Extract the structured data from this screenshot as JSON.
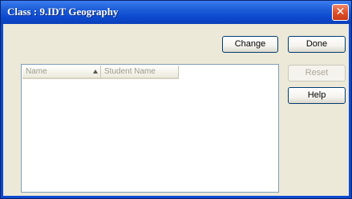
{
  "window": {
    "title": "Class : 9.IDT Geography",
    "close_glyph": "✕"
  },
  "buttons": {
    "change": "Change",
    "done": "Done",
    "reset": "Reset",
    "help": "Help"
  },
  "list": {
    "columns": [
      {
        "label": "Name",
        "sorted": "ascending"
      },
      {
        "label": "Student Name"
      }
    ],
    "rows": []
  },
  "colors": {
    "title_bar": "#0c4ad0",
    "dialog_background": "#ece9d8",
    "close_button": "#e0502a"
  }
}
